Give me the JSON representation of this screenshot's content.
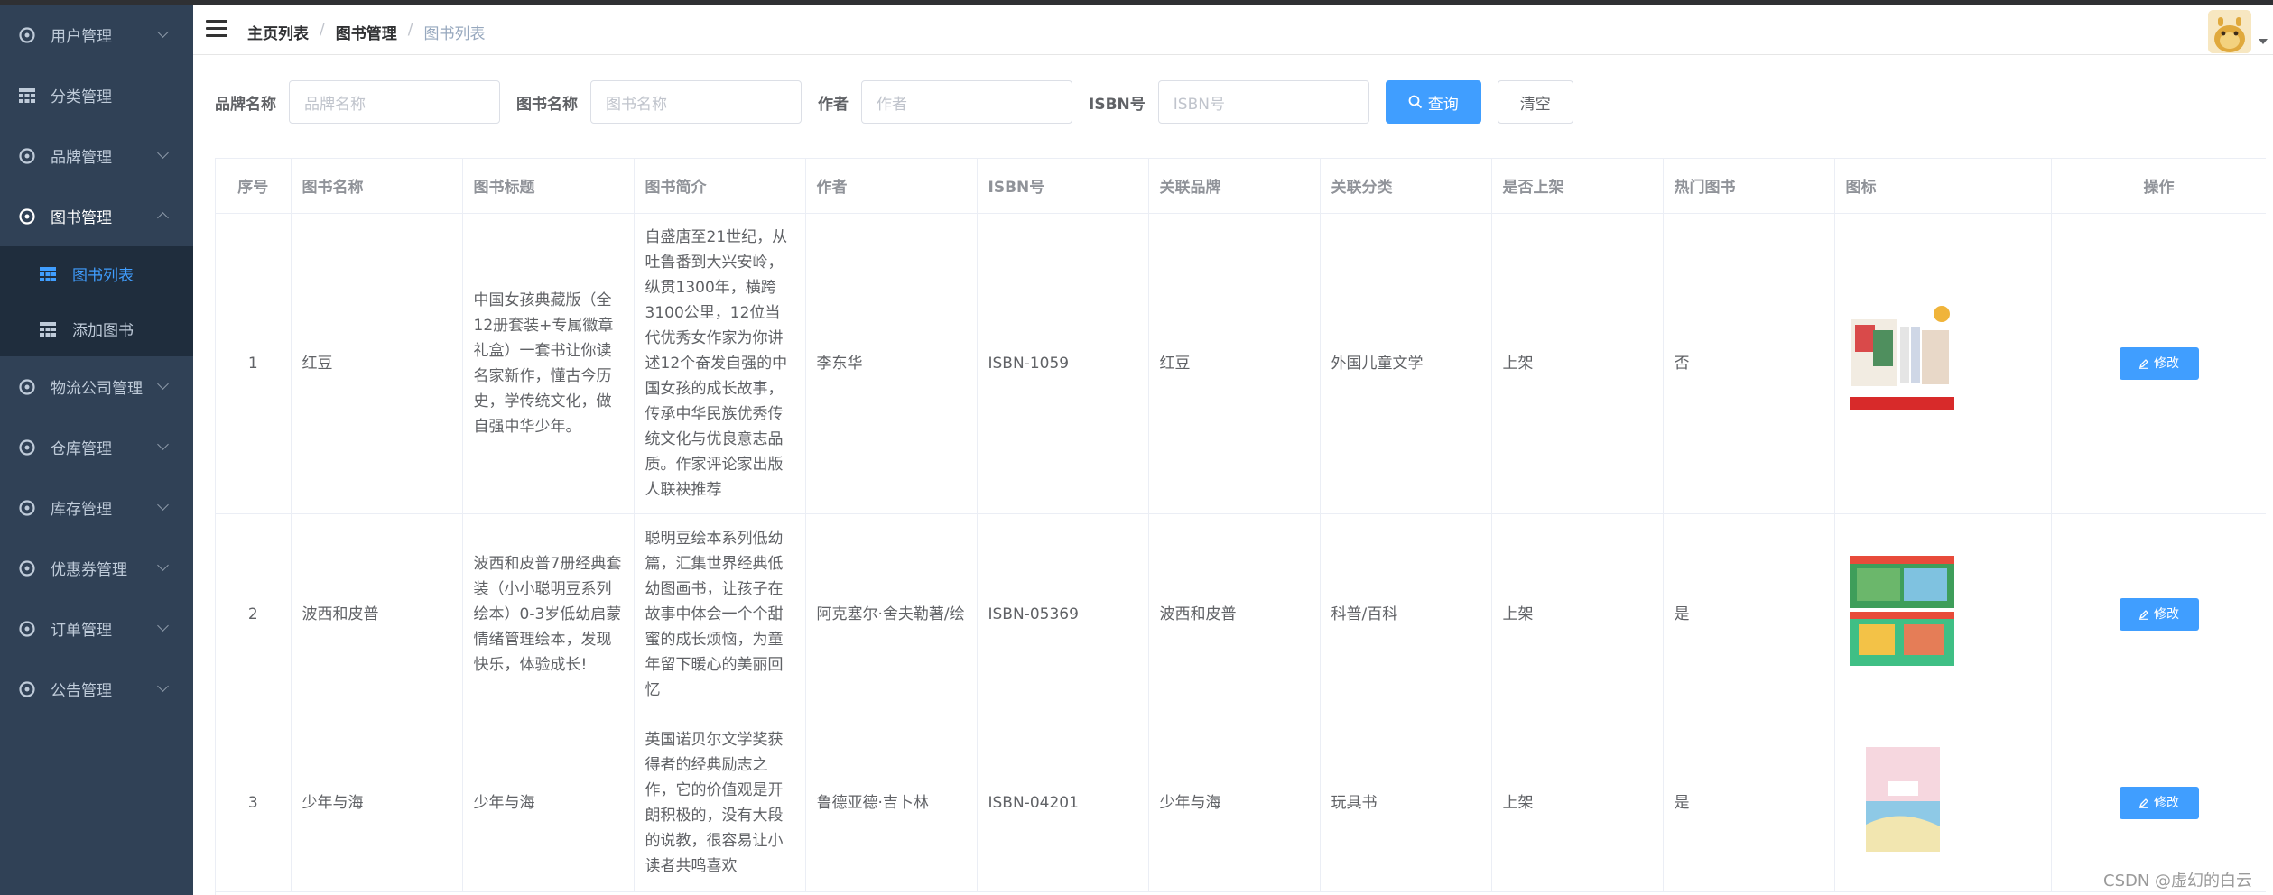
{
  "sidebar": {
    "items": [
      {
        "label": "用户管理",
        "icon": "gear-icon"
      },
      {
        "label": "分类管理",
        "icon": "table-icon"
      },
      {
        "label": "品牌管理",
        "icon": "gear-icon"
      },
      {
        "label": "图书管理",
        "icon": "gear-icon"
      },
      {
        "label": "物流公司管理",
        "icon": "gear-icon"
      },
      {
        "label": "仓库管理",
        "icon": "gear-icon"
      },
      {
        "label": "库存管理",
        "icon": "gear-icon"
      },
      {
        "label": "优惠券管理",
        "icon": "gear-icon"
      },
      {
        "label": "订单管理",
        "icon": "gear-icon"
      },
      {
        "label": "公告管理",
        "icon": "gear-icon"
      }
    ],
    "book_sub": [
      {
        "label": "图书列表",
        "icon": "table-icon"
      },
      {
        "label": "添加图书",
        "icon": "table-icon"
      }
    ]
  },
  "breadcrumb": [
    "主页列表",
    "图书管理",
    "图书列表"
  ],
  "filters": {
    "brand_label": "品牌名称",
    "brand_placeholder": "品牌名称",
    "book_label": "图书名称",
    "book_placeholder": "图书名称",
    "author_label": "作者",
    "author_placeholder": "作者",
    "isbn_label": "ISBN号",
    "isbn_placeholder": "ISBN号",
    "search_label": "查询",
    "clear_label": "清空"
  },
  "table": {
    "headers": [
      "序号",
      "图书名称",
      "图书标题",
      "图书简介",
      "作者",
      "ISBN号",
      "关联品牌",
      "关联分类",
      "是否上架",
      "热门图书",
      "图标",
      "操作"
    ],
    "edit_label": "修改",
    "rows": [
      {
        "no": "1",
        "name": "红豆",
        "title": "中国女孩典藏版（全12册套装+专属徽章礼盒）一套书让你读名家新作，懂古今历史，学传统文化，做自强中华少年。",
        "intro": "自盛唐至21世纪，从吐鲁番到大兴安岭，纵贯1300年，横跨3100公里，12位当代优秀女作家为你讲述12个奋发自强的中国女孩的成长故事，传承中华民族优秀传统文化与优良意志品质。作家评论家出版人联袂推荐",
        "author": "李东华",
        "isbn": "ISBN-1059",
        "brand": "红豆",
        "category": "外国儿童文学",
        "on_shelf": "上架",
        "hot": "否"
      },
      {
        "no": "2",
        "name": "波西和皮普",
        "title": "波西和皮普7册经典套装（小小聪明豆系列绘本）0-3岁低幼启蒙情绪管理绘本，发现快乐，体验成长!",
        "intro": "聪明豆绘本系列低幼篇，汇集世界经典低幼图画书，让孩子在故事中体会一个个甜蜜的成长烦恼，为童年留下暖心的美丽回忆",
        "author": "阿克塞尔·舍夫勒著/绘",
        "isbn": "ISBN-05369",
        "brand": "波西和皮普",
        "category": "科普/百科",
        "on_shelf": "上架",
        "hot": "是"
      },
      {
        "no": "3",
        "name": "少年与海",
        "title": "少年与海",
        "intro": "英国诺贝尔文学奖获得者的经典励志之作，它的价值观是开朗积极的，没有大段的说教，很容易让小读者共鸣喜欢",
        "author": "鲁德亚德·吉卜林",
        "isbn": "ISBN-04201",
        "brand": "少年与海",
        "category": "玩具书",
        "on_shelf": "上架",
        "hot": "是"
      }
    ]
  },
  "watermark": "CSDN @虚幻的白云"
}
